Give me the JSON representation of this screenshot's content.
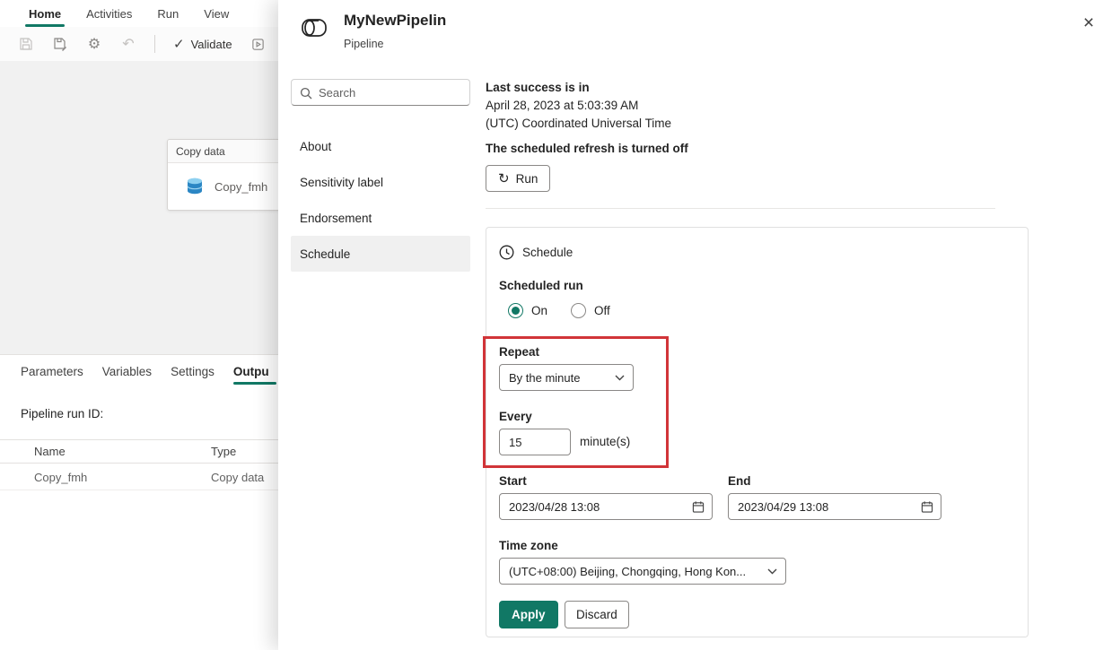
{
  "app": {
    "menu": {
      "tabs": [
        {
          "label": "Home",
          "active": true
        },
        {
          "label": "Activities",
          "active": false
        },
        {
          "label": "Run",
          "active": false
        },
        {
          "label": "View",
          "active": false
        }
      ]
    },
    "toolbar": {
      "validate": "Validate"
    },
    "canvas": {
      "card": {
        "header": "Copy data",
        "name": "Copy_fmh"
      }
    },
    "bottom": {
      "tabs": [
        {
          "label": "Parameters",
          "active": false
        },
        {
          "label": "Variables",
          "active": false
        },
        {
          "label": "Settings",
          "active": false
        },
        {
          "label": "Outpu",
          "active": true
        }
      ],
      "run_id_label": "Pipeline run ID:",
      "table": {
        "col_name": "Name",
        "col_type": "Type",
        "row_name": "Copy_fmh",
        "row_type": "Copy data"
      }
    }
  },
  "dialog": {
    "title": "MyNewPipelin",
    "subtitle": "Pipeline",
    "search": {
      "placeholder": "Search"
    },
    "nav": [
      {
        "label": "About",
        "active": false
      },
      {
        "label": "Sensitivity label",
        "active": false
      },
      {
        "label": "Endorsement",
        "active": false
      },
      {
        "label": "Schedule",
        "active": true
      }
    ],
    "info": {
      "last_success_label": "Last success is in",
      "last_success_value": "April 28, 2023 at 5:03:39 AM",
      "last_success_tz": "(UTC) Coordinated Universal Time",
      "refresh_off": "The scheduled refresh is turned off",
      "run": "Run",
      "refresh_glyph": "↻"
    },
    "schedule": {
      "title": "Schedule",
      "scheduled_run": "Scheduled run",
      "on": "On",
      "off": "Off",
      "repeat_label": "Repeat",
      "repeat_value": "By the minute",
      "every_label": "Every",
      "every_value": "15",
      "every_unit": "minute(s)",
      "start_label": "Start",
      "start_value": "2023/04/28 13:08",
      "end_label": "End",
      "end_value": "2023/04/29 13:08",
      "timezone_label": "Time zone",
      "timezone_value": "(UTC+08:00) Beijing, Chongqing, Hong Kon...",
      "apply": "Apply",
      "discard": "Discard"
    },
    "close_glyph": "×"
  },
  "colors": {
    "accent": "#117865",
    "highlight": "#d13438"
  }
}
